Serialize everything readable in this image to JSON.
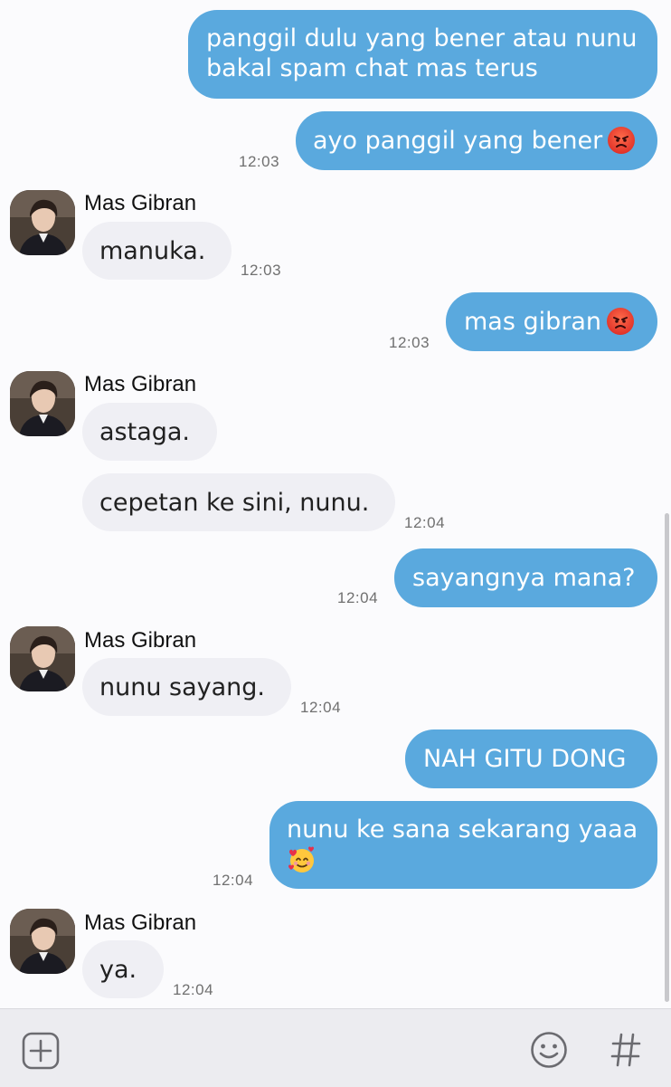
{
  "contact": {
    "name": "Mas Gibran"
  },
  "messages": [
    {
      "lines": [
        "panggil dulu yang bener atau nunu",
        "bakal spam chat mas terus"
      ],
      "time": ""
    },
    {
      "text": "ayo panggil yang bener",
      "emoji": "angry-face-emoji",
      "time": "12:03"
    },
    {
      "text": "manuka.",
      "time": "12:03"
    },
    {
      "text": "mas gibran",
      "emoji": "angry-face-emoji",
      "time": "12:03"
    },
    {
      "text": "astaga.",
      "time": ""
    },
    {
      "text": "cepetan ke sini, nunu.",
      "time": "12:04"
    },
    {
      "text": "sayangnya mana?",
      "time": "12:04"
    },
    {
      "text": "nunu sayang.",
      "time": "12:04"
    },
    {
      "text": "NAH GITU DONG",
      "time": ""
    },
    {
      "text": "nunu ke sana sekarang yaaa",
      "emoji": "smiling-face-with-hearts-emoji",
      "time": "12:04"
    },
    {
      "text": "ya.",
      "time": "12:04"
    }
  ],
  "icons": {
    "add": "plus-square-icon",
    "sticker": "smiley-icon",
    "hashtag": "hashtag-icon"
  },
  "colors": {
    "outgoing_bubble": "#5aa9de",
    "incoming_bubble": "#efeff4",
    "background": "#fbfbfd"
  }
}
